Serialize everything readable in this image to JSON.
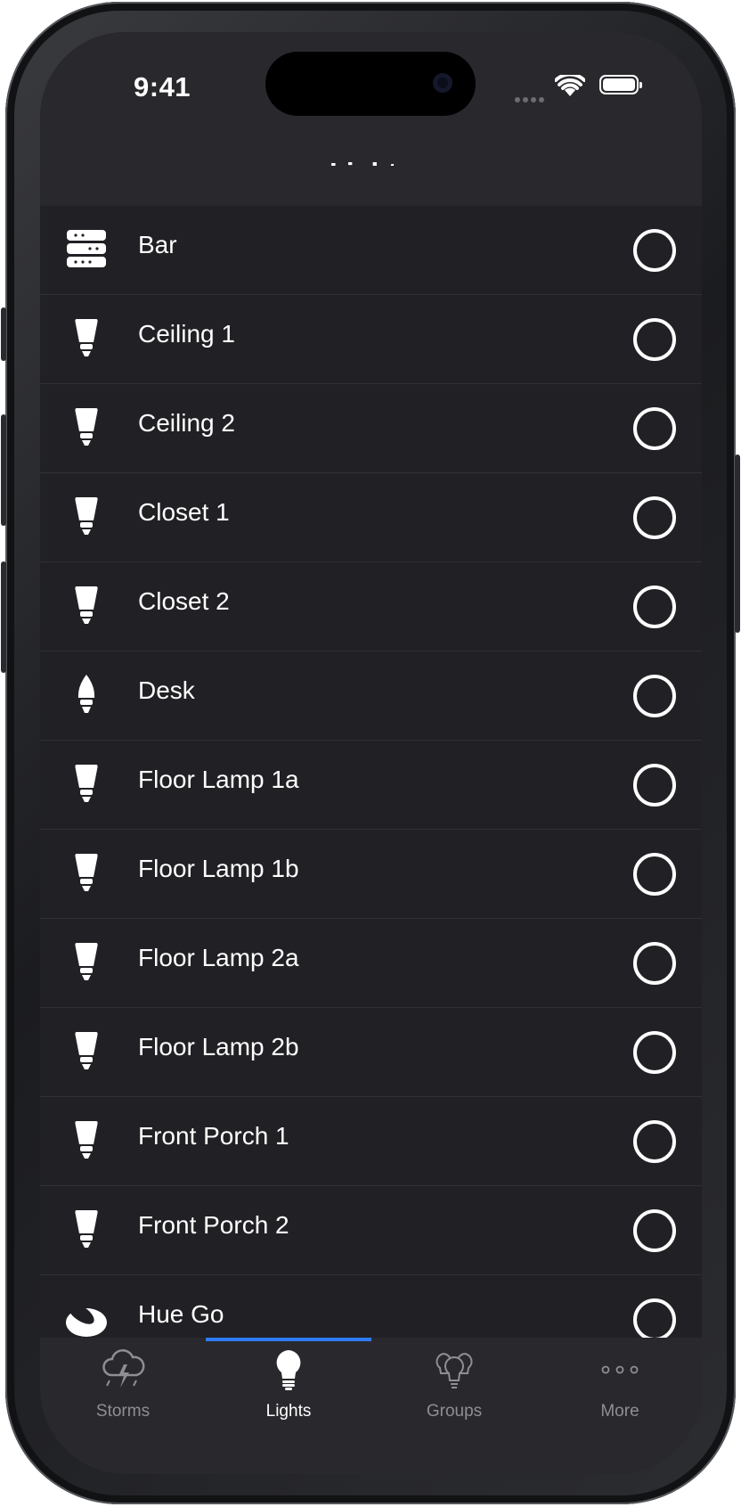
{
  "status_bar": {
    "time": "9:41"
  },
  "nav": {
    "title": "Lights"
  },
  "lights": [
    {
      "name": "Bar",
      "icon": "lightstrip-icon",
      "on": false
    },
    {
      "name": "Ceiling 1",
      "icon": "bulb-icon",
      "on": false
    },
    {
      "name": "Ceiling 2",
      "icon": "bulb-icon",
      "on": false
    },
    {
      "name": "Closet 1",
      "icon": "bulb-icon",
      "on": false
    },
    {
      "name": "Closet 2",
      "icon": "bulb-icon",
      "on": false
    },
    {
      "name": "Desk",
      "icon": "candle-bulb-icon",
      "on": false
    },
    {
      "name": "Floor Lamp 1a",
      "icon": "bulb-icon",
      "on": false
    },
    {
      "name": "Floor Lamp 1b",
      "icon": "bulb-icon",
      "on": false
    },
    {
      "name": "Floor Lamp 2a",
      "icon": "bulb-icon",
      "on": false
    },
    {
      "name": "Floor Lamp 2b",
      "icon": "bulb-icon",
      "on": false
    },
    {
      "name": "Front Porch 1",
      "icon": "bulb-icon",
      "on": false
    },
    {
      "name": "Front Porch 2",
      "icon": "bulb-icon",
      "on": false
    },
    {
      "name": "Hue Go",
      "icon": "hue-go-icon",
      "on": false
    }
  ],
  "tabs": [
    {
      "label": "Storms",
      "icon": "storm-cloud-icon",
      "active": false
    },
    {
      "label": "Lights",
      "icon": "lightbulb-icon",
      "active": true
    },
    {
      "label": "Groups",
      "icon": "bulb-group-icon",
      "active": false
    },
    {
      "label": "More",
      "icon": "ellipsis-icon",
      "active": false
    }
  ],
  "colors": {
    "background": "#212125",
    "bar_background": "#29292d",
    "accent": "#2f7bf6",
    "text": "#ffffff",
    "inactive_tab": "#8e8e93"
  }
}
